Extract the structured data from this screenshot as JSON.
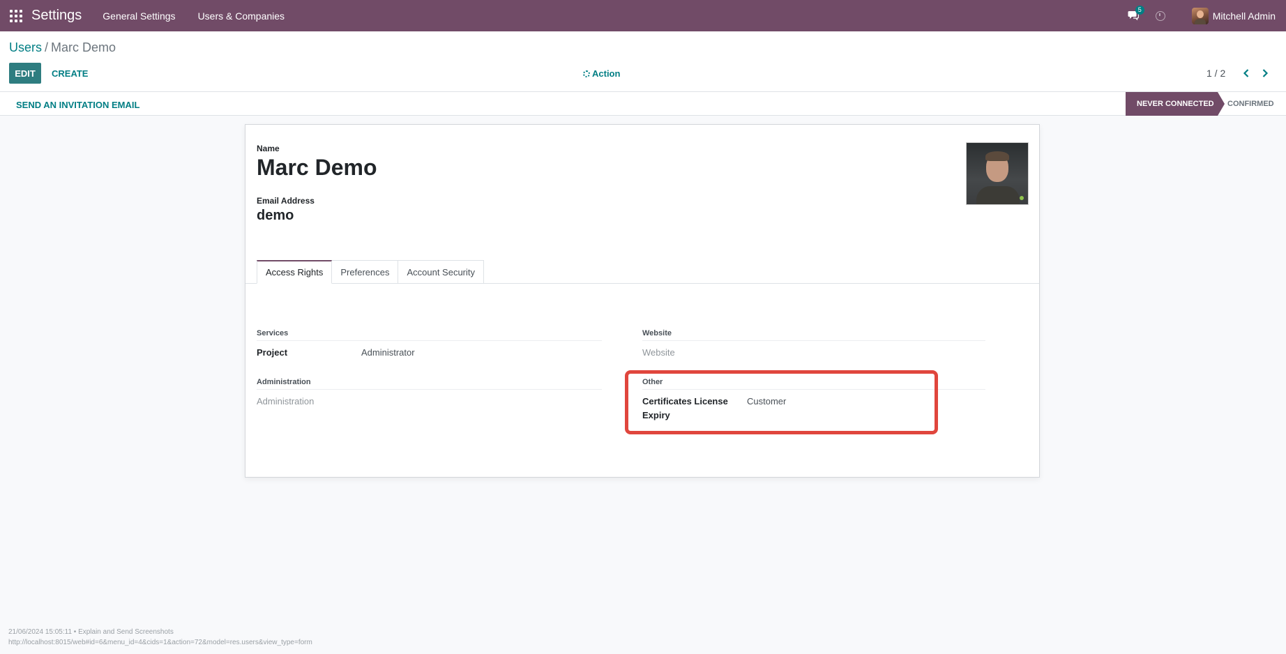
{
  "navbar": {
    "app_title": "Settings",
    "menu": [
      "General Settings",
      "Users & Companies"
    ],
    "messages_count": "5",
    "user_name": "Mitchell Admin",
    "icons": {
      "apps": "apps-grid-icon",
      "chat": "chat-icon",
      "activity": "clock-icon"
    },
    "brand_color": "#714b67"
  },
  "breadcrumb": {
    "parent": "Users",
    "separator": "/",
    "current": "Marc Demo"
  },
  "toolbar": {
    "edit_label": "EDIT",
    "create_label": "CREATE",
    "action_label": "Action"
  },
  "pager": {
    "value": "1 / 2"
  },
  "statusbar": {
    "invite_label": "SEND AN INVITATION EMAIL",
    "stages": [
      "NEVER CONNECTED",
      "CONFIRMED"
    ],
    "active_stage": "NEVER CONNECTED"
  },
  "form": {
    "name_label": "Name",
    "name_value": "Marc Demo",
    "email_label": "Email Address",
    "email_value": "demo",
    "tabs": [
      "Access Rights",
      "Preferences",
      "Account Security"
    ],
    "active_tab": "Access Rights",
    "groups": {
      "services": {
        "title": "Services",
        "project_label": "Project",
        "project_value": "Administrator"
      },
      "administration": {
        "title": "Administration",
        "placeholder": "Administration"
      },
      "website": {
        "title": "Website",
        "placeholder": "Website"
      },
      "other": {
        "title": "Other",
        "cert_label_line1": "Certificates License",
        "cert_label_line2": "Expiry",
        "cert_value": "Customer"
      }
    }
  },
  "footer": {
    "line1": "21/06/2024 15:05:11 • Explain and Send Screenshots",
    "line2": "http://localhost:8015/web#id=6&menu_id=4&cids=1&action=72&model=res.users&view_type=form"
  },
  "colors": {
    "accent": "#017e84",
    "highlight": "#e0463d"
  }
}
